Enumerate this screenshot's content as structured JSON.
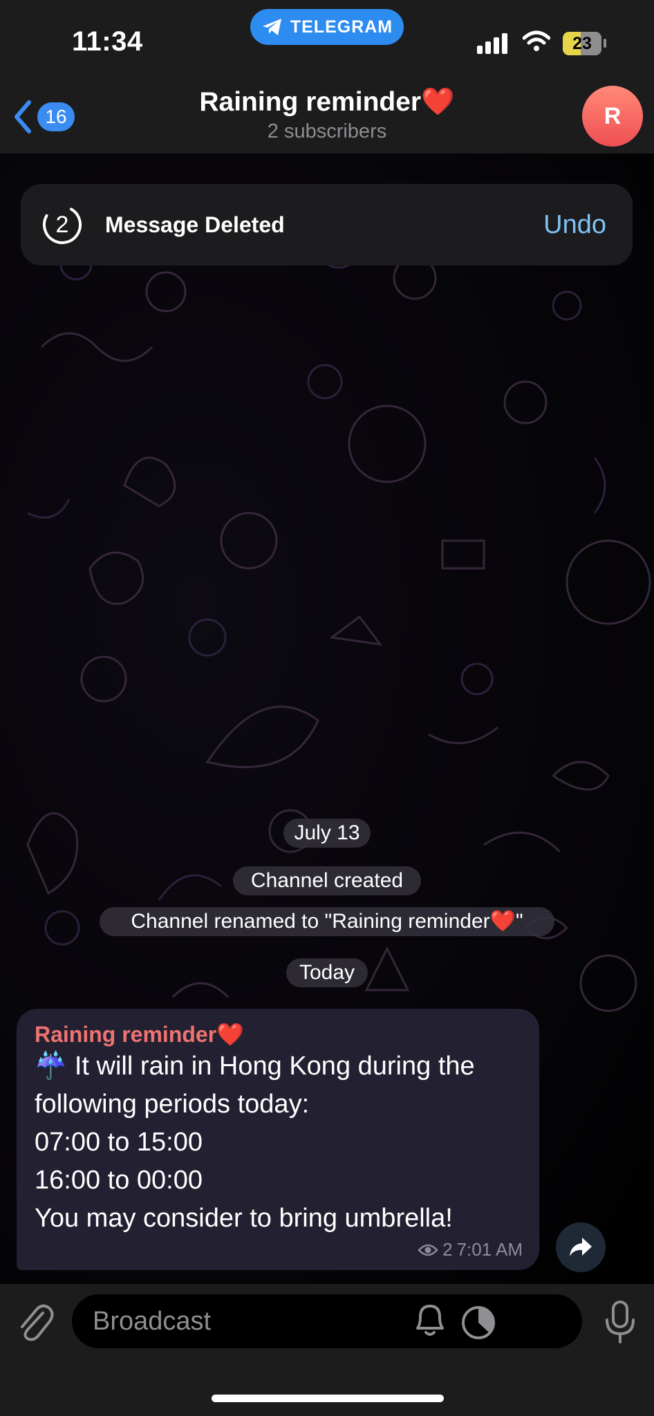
{
  "status": {
    "time": "11:34",
    "app_pill": "TELEGRAM",
    "battery": "23"
  },
  "header": {
    "back_count": "16",
    "title": "Raining reminder❤️",
    "subtitle": "2 subscribers",
    "avatar_letter": "R"
  },
  "toast": {
    "countdown": "2",
    "message": "Message Deleted",
    "undo": "Undo"
  },
  "service": {
    "date1": "July 13",
    "created": "Channel created",
    "renamed": "Channel renamed to \"Raining reminder❤️\"",
    "date2": "Today"
  },
  "message": {
    "author": "Raining reminder❤️",
    "lines": [
      "☔ It will rain in Hong Kong during the",
      "following periods today:",
      "07:00 to 15:00",
      "16:00 to 00:00",
      "You may consider to bring umbrella!"
    ],
    "views": "2",
    "time": "7:01 AM"
  },
  "composer": {
    "placeholder": "Broadcast"
  },
  "colors": {
    "accent": "#3a8cf0",
    "author": "#ee7371",
    "undo": "#7fc3f5"
  },
  "icons": [
    "telegram-plane-icon",
    "back-chevron-icon",
    "countdown-ring-icon",
    "eye-icon",
    "forward-icon",
    "paperclip-icon",
    "bell-icon",
    "timer-icon",
    "mic-icon"
  ]
}
